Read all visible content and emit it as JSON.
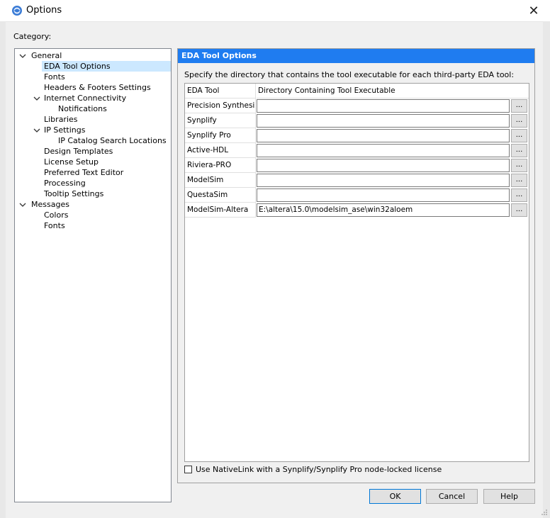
{
  "window": {
    "title": "Options",
    "close_symbol": "✕",
    "icon": "app-globe-icon"
  },
  "category_label": "Category:",
  "tree": {
    "items": [
      {
        "label": "General",
        "level": 0,
        "expanded": true
      },
      {
        "label": "EDA Tool Options",
        "level": 1,
        "selected": true
      },
      {
        "label": "Fonts",
        "level": 1
      },
      {
        "label": "Headers & Footers Settings",
        "level": 1
      },
      {
        "label": "Internet Connectivity",
        "level": 1,
        "expanded": true
      },
      {
        "label": "Notifications",
        "level": 2
      },
      {
        "label": "Libraries",
        "level": 1
      },
      {
        "label": "IP Settings",
        "level": 1,
        "expanded": true
      },
      {
        "label": "IP Catalog Search Locations",
        "level": 2
      },
      {
        "label": "Design Templates",
        "level": 1
      },
      {
        "label": "License Setup",
        "level": 1
      },
      {
        "label": "Preferred Text Editor",
        "level": 1
      },
      {
        "label": "Processing",
        "level": 1
      },
      {
        "label": "Tooltip Settings",
        "level": 1
      },
      {
        "label": "Messages",
        "level": 0,
        "expanded": true
      },
      {
        "label": "Colors",
        "level": 1
      },
      {
        "label": "Fonts",
        "level": 1
      }
    ]
  },
  "panel": {
    "header": "EDA Tool Options",
    "description": "Specify the directory that contains the tool executable for each third-party EDA tool:",
    "table": {
      "col_tool": "EDA Tool",
      "col_dir": "Directory Containing Tool Executable",
      "browse_label": "...",
      "rows": [
        {
          "tool": "Precision Synthesis",
          "path": ""
        },
        {
          "tool": "Synplify",
          "path": ""
        },
        {
          "tool": "Synplify Pro",
          "path": ""
        },
        {
          "tool": "Active-HDL",
          "path": ""
        },
        {
          "tool": "Riviera-PRO",
          "path": ""
        },
        {
          "tool": "ModelSim",
          "path": ""
        },
        {
          "tool": "QuestaSim",
          "path": ""
        },
        {
          "tool": "ModelSim-Altera",
          "path": "E:\\altera\\15.0\\modelsim_ase\\win32aloem"
        }
      ]
    },
    "nativelink": {
      "label": "Use NativeLink with a Synplify/Synplify Pro node-locked license",
      "checked": false
    }
  },
  "buttons": {
    "ok": "OK",
    "cancel": "Cancel",
    "help": "Help"
  }
}
